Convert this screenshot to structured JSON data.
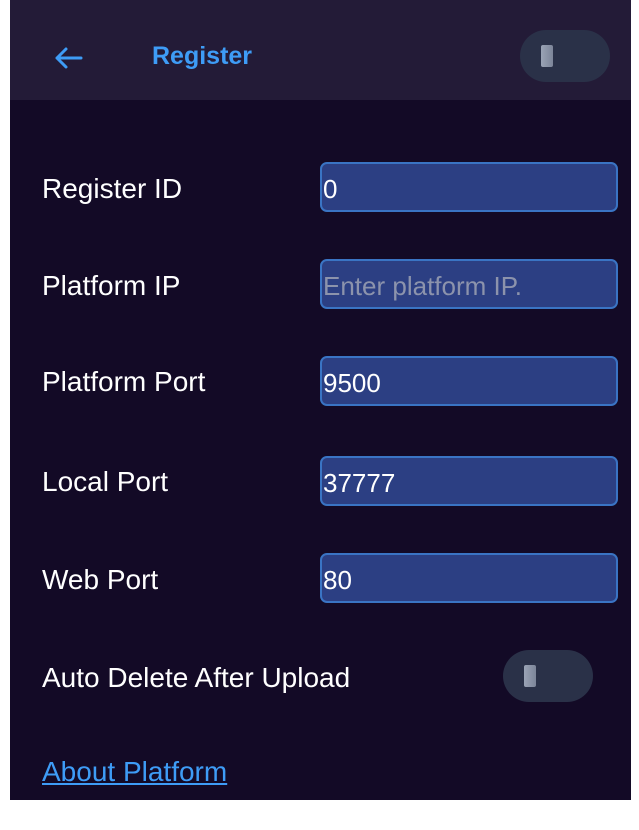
{
  "header": {
    "title": "Register",
    "back_icon": "arrow-left-icon",
    "toggle_on": false
  },
  "form": {
    "rows": [
      {
        "label": "Register ID",
        "value": "0",
        "placeholder": ""
      },
      {
        "label": "Platform IP",
        "value": "",
        "placeholder": "Enter platform IP."
      },
      {
        "label": "Platform Port",
        "value": "9500",
        "placeholder": ""
      },
      {
        "label": "Local Port",
        "value": "37777",
        "placeholder": ""
      },
      {
        "label": "Web Port",
        "value": "80",
        "placeholder": ""
      }
    ],
    "auto_delete": {
      "label": "Auto Delete After Upload",
      "on": false
    }
  },
  "footer": {
    "about_link": "About Platform"
  },
  "colors": {
    "background": "#130a26",
    "header": "#231b37",
    "accent": "#3e9cf6",
    "field_fill": "#2c3f83",
    "field_border": "#3a74c4"
  }
}
